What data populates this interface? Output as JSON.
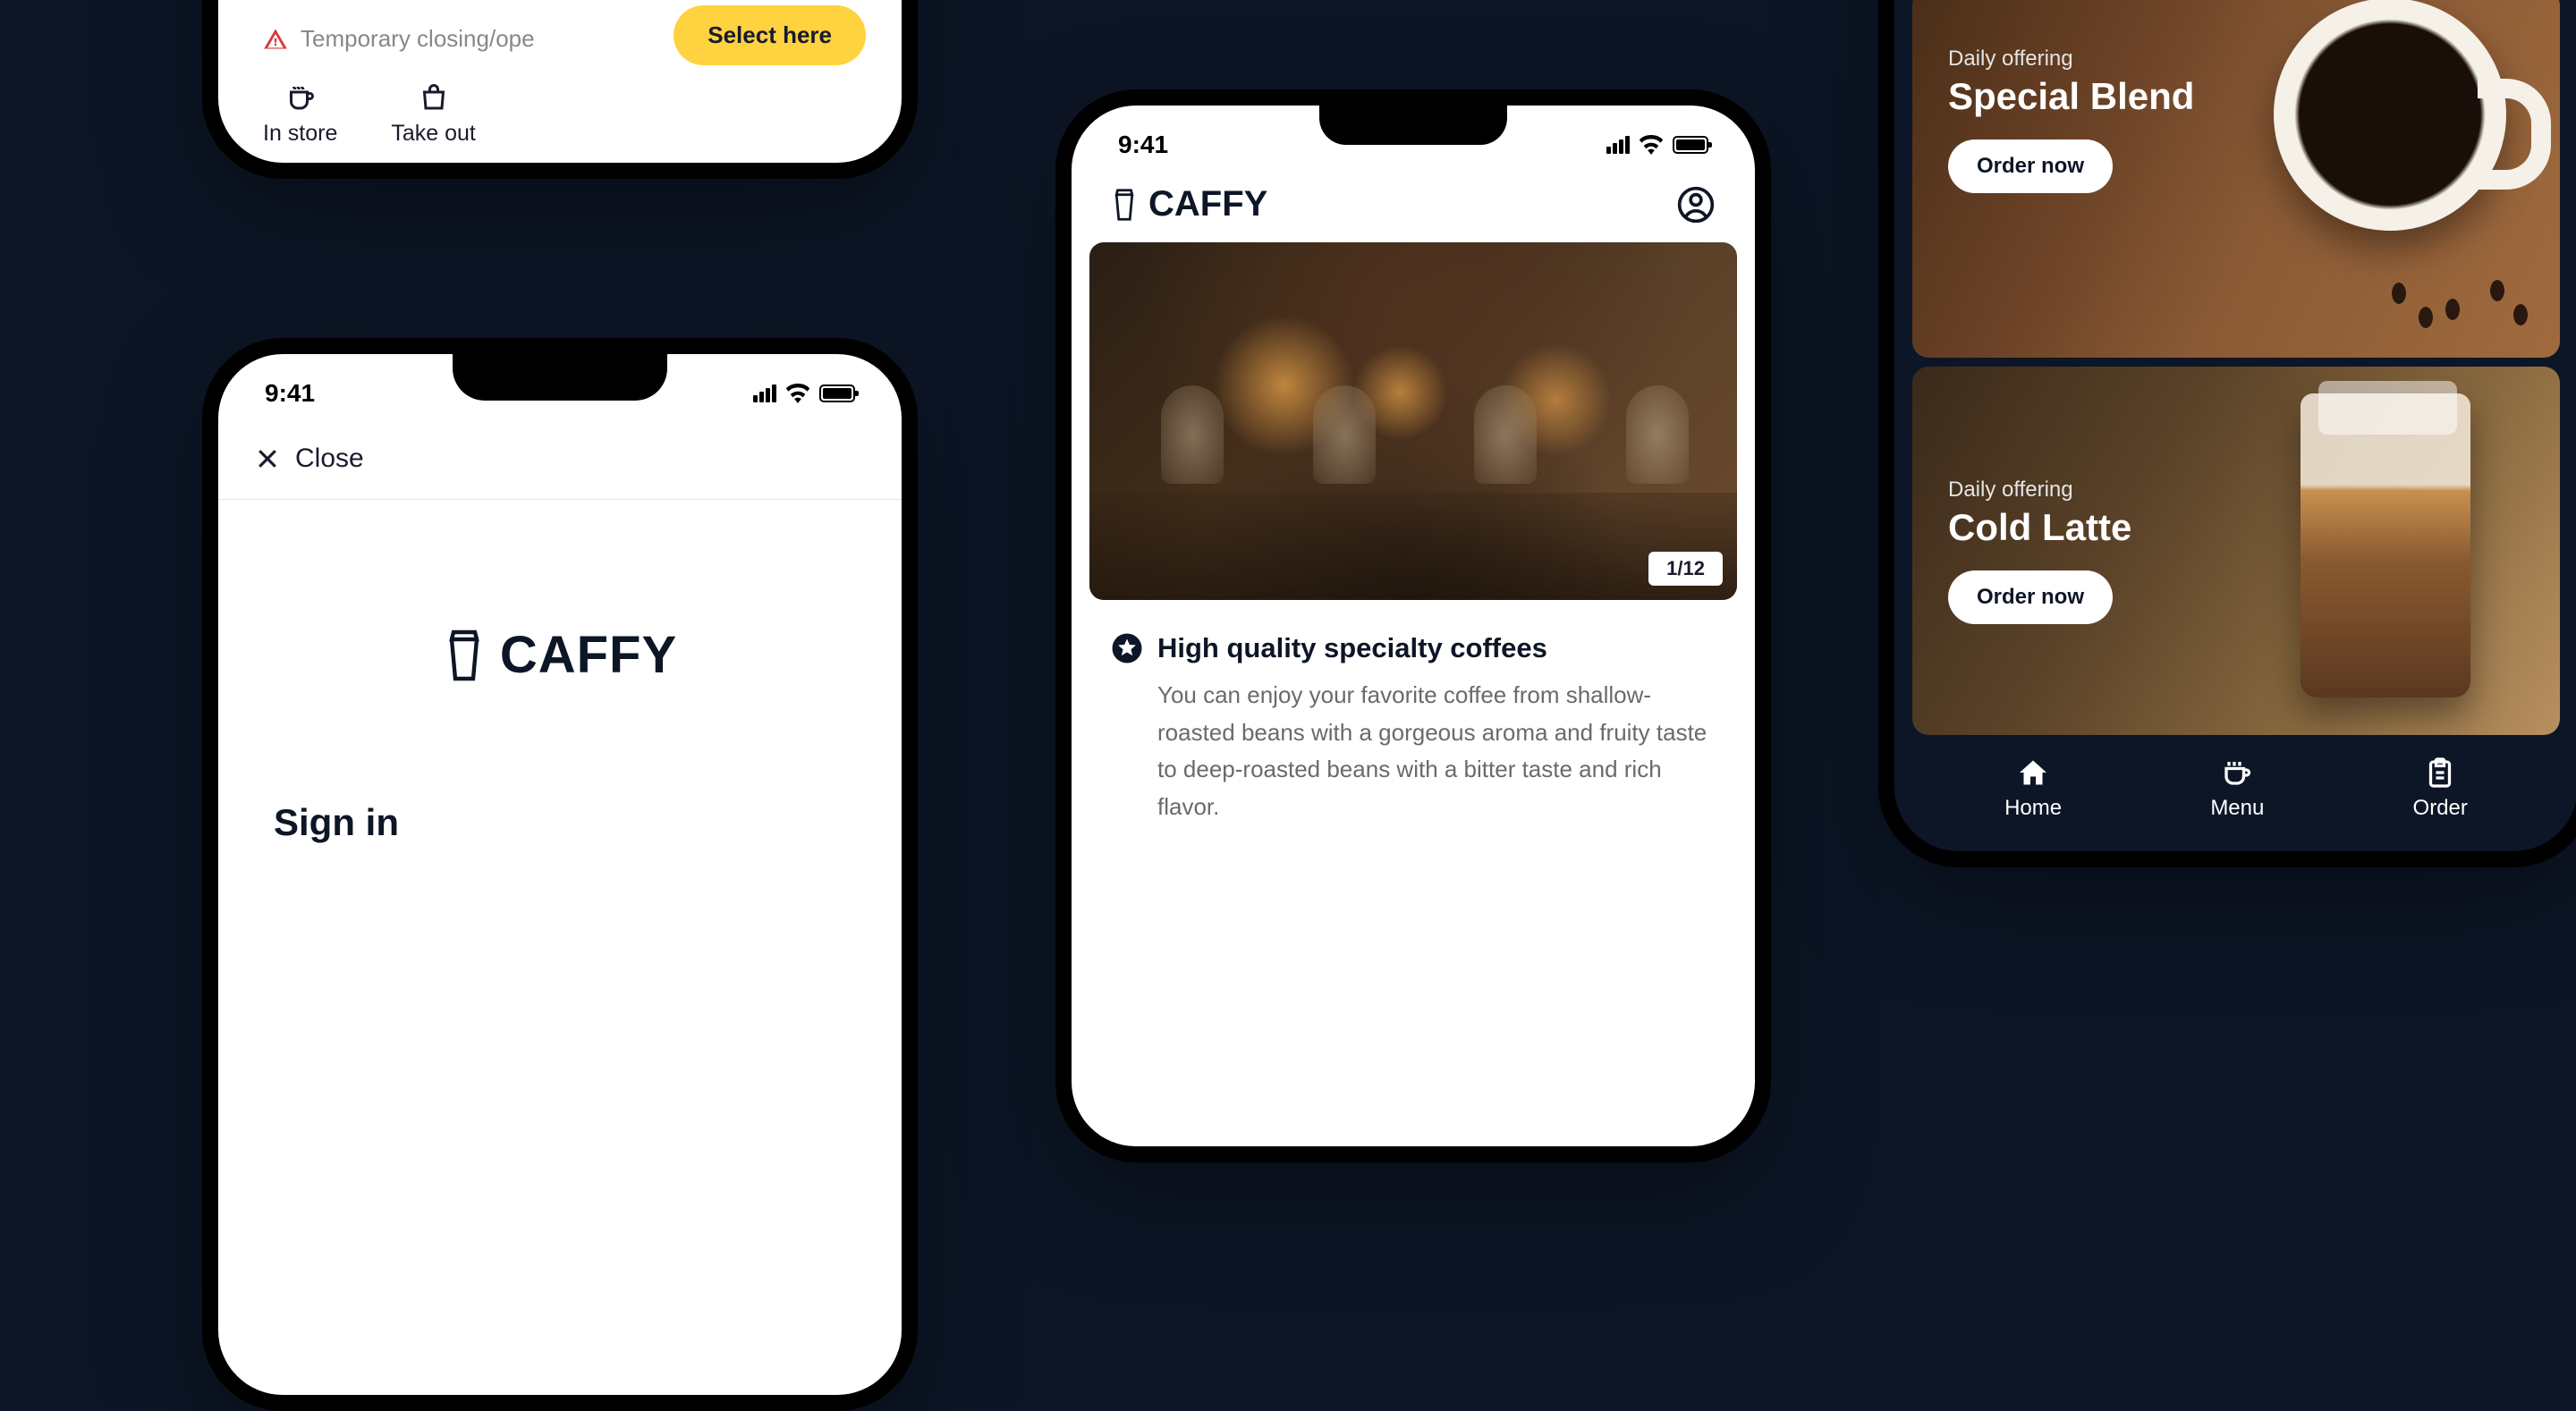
{
  "status": {
    "time": "9:41"
  },
  "phone1": {
    "warning_text": "Temporary closing/ope",
    "select_button": "Select here",
    "options": [
      {
        "icon": "cup-icon",
        "label": "In store"
      },
      {
        "icon": "bag-icon",
        "label": "Take out"
      }
    ]
  },
  "phone2": {
    "close_label": "Close",
    "brand": "CAFFY",
    "signin_label": "Sign in"
  },
  "phone3": {
    "brand": "CAFFY",
    "image_counter": "1/12",
    "headline": "High quality specialty coffees",
    "body": "You can enjoy your favorite coffee from shallow-roasted beans with a gorgeous aroma and fruity taste to deep-roasted beans with a bitter taste and rich flavor."
  },
  "phone4": {
    "cards": [
      {
        "eyebrow": "Daily offering",
        "title": "Special Blend",
        "cta": "Order now"
      },
      {
        "eyebrow": "Daily offering",
        "title": "Cold Latte",
        "cta": "Order now"
      }
    ],
    "nav": [
      {
        "icon": "home-icon",
        "label": "Home"
      },
      {
        "icon": "menu-cup-icon",
        "label": "Menu"
      },
      {
        "icon": "clipboard-icon",
        "label": "Order"
      }
    ]
  }
}
